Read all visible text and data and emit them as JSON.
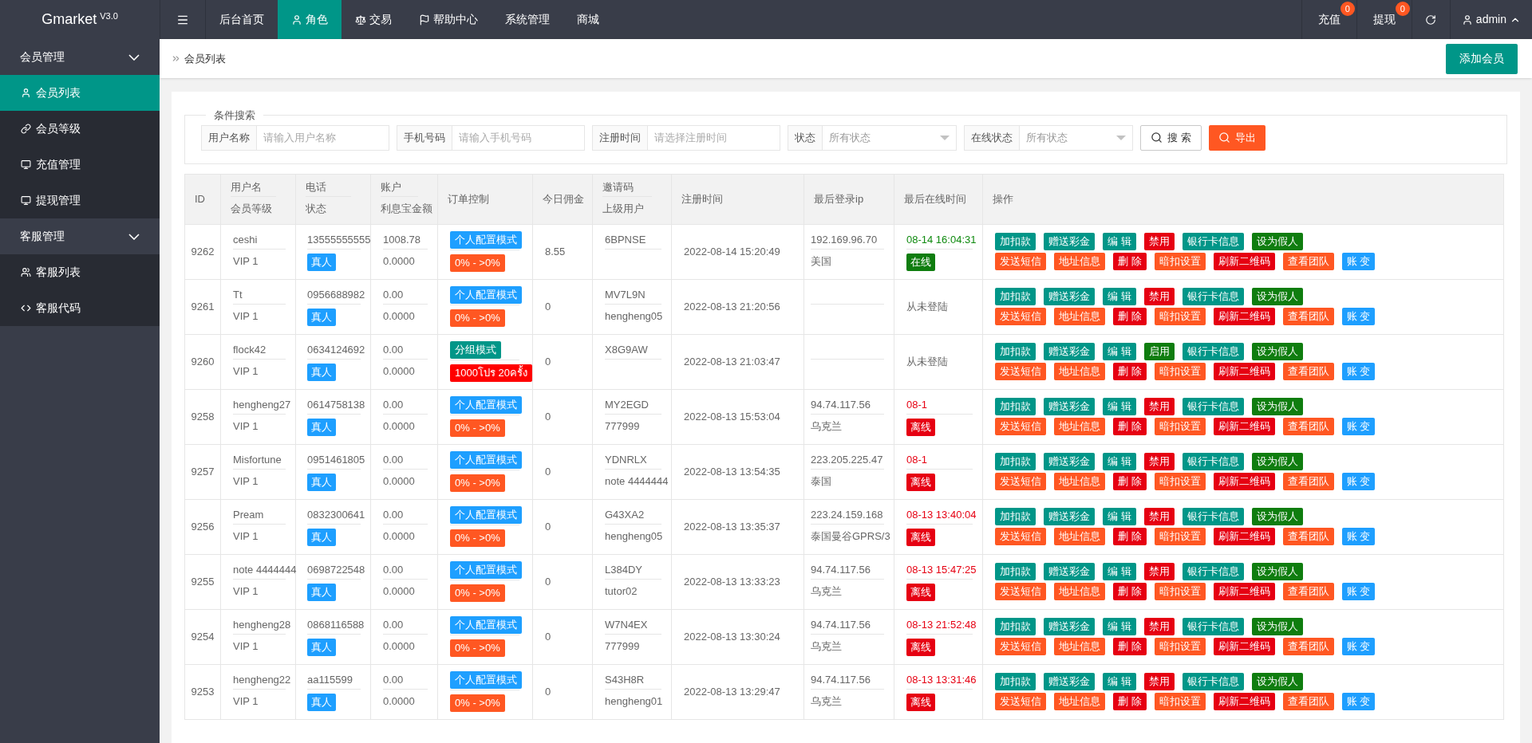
{
  "app": {
    "logo": "Gmarket",
    "version": "V3.0"
  },
  "top_nav": [
    {
      "label": "后台首页",
      "selected": false
    },
    {
      "label": "角色",
      "selected": true
    },
    {
      "label": "交易",
      "selected": false
    },
    {
      "label": "帮助中心",
      "selected": false
    },
    {
      "label": "系统管理",
      "selected": false
    },
    {
      "label": "商城",
      "selected": false
    }
  ],
  "top_right": [
    {
      "label": "充值",
      "badge": "0"
    },
    {
      "label": "提现",
      "badge": "0"
    }
  ],
  "user": "admin",
  "sidebar": [
    {
      "label": "会员管理",
      "expanded": true,
      "items": [
        {
          "label": "会员列表",
          "selected": true
        },
        {
          "label": "会员等级",
          "selected": false
        },
        {
          "label": "充值管理",
          "selected": false
        },
        {
          "label": "提现管理",
          "selected": false
        }
      ]
    },
    {
      "label": "客服管理",
      "expanded": true,
      "items": [
        {
          "label": "客服列表",
          "selected": false
        },
        {
          "label": "客服代码",
          "selected": false
        }
      ]
    }
  ],
  "breadcrumb": "会员列表",
  "add_button": "添加会员",
  "search": {
    "legend": "条件搜索",
    "fields": [
      {
        "kind": "text",
        "label": "用户名称",
        "placeholder": "请输入用户名称"
      },
      {
        "kind": "text",
        "label": "手机号码",
        "placeholder": "请输入手机号码"
      },
      {
        "kind": "text",
        "label": "注册时间",
        "placeholder": "请选择注册时间"
      },
      {
        "kind": "select",
        "label": "状态",
        "placeholder": "所有状态"
      },
      {
        "kind": "select",
        "label": "在线状态",
        "placeholder": "所有状态"
      }
    ],
    "buttons": [
      {
        "kind": "outline",
        "label": "搜 索"
      },
      {
        "kind": "primary",
        "label": "导出"
      }
    ]
  },
  "table": {
    "columns": [
      [
        "ID"
      ],
      [
        "用户名",
        "会员等级"
      ],
      [
        "电话",
        "状态"
      ],
      [
        "账户",
        "利息宝金额"
      ],
      [
        "订单控制"
      ],
      [
        "今日佣金"
      ],
      [
        "邀请码",
        "上级用户"
      ],
      [
        "注册时间"
      ],
      [
        "最后登录ip"
      ],
      [
        "最后在线时间"
      ],
      [
        "操作"
      ]
    ],
    "rows": [
      {
        "id": "9262",
        "username": "ceshi",
        "level": "VIP 1",
        "phone": "13555555555",
        "member_type": "真人",
        "balance": "1008.78",
        "interest": "0.0000",
        "order_mode": {
          "label": "个人配置模式",
          "color": "#1e9fff"
        },
        "order_range": {
          "label": "0% - >0%",
          "color": "#ff5722"
        },
        "commission": "8.55",
        "invite_code": "6BPNSE",
        "registered": "2022-08-14 15:20:49",
        "ip": "192.169.96.70",
        "location": "美国",
        "last_online": {
          "kind": "online",
          "text": "08-14 16:04:31",
          "badge": "在线"
        },
        "action_rows": [
          [
            {
              "label": "加扣款",
              "color": "#009688"
            },
            {
              "label": "赠送彩金",
              "color": "#009688"
            },
            {
              "label": "编 辑",
              "color": "#009688"
            },
            {
              "label": "禁用",
              "color": "#e60012"
            },
            {
              "label": "银行卡信息",
              "color": "#009688"
            },
            {
              "label": "设为假人",
              "color": "#0f7d0f"
            }
          ],
          [
            {
              "label": "发送短信",
              "color": "#ff5722"
            },
            {
              "label": "地址信息",
              "color": "#ff5722"
            },
            {
              "label": "删 除",
              "color": "#e60012"
            },
            {
              "label": "暗扣设置",
              "color": "#ff5722"
            },
            {
              "label": "刷新二维码",
              "color": "#e60012"
            },
            {
              "label": "查看团队",
              "color": "#ff5722"
            },
            {
              "label": "账 变",
              "color": "#1e9fff"
            }
          ]
        ]
      },
      {
        "id": "9261",
        "username": "Tt",
        "level": "VIP 1",
        "phone": "0956688982",
        "member_type": "真人",
        "balance": "0.00",
        "interest": "0.0000",
        "order_mode": {
          "label": "个人配置模式",
          "color": "#1e9fff"
        },
        "order_range": {
          "label": "0% - >0%",
          "color": "#ff5722"
        },
        "commission": "0",
        "invite_code": "MV7L9N",
        "parent": "hengheng05",
        "registered": "2022-08-13 21:20:56",
        "last_online": {
          "kind": "never",
          "text": "从未登陆"
        },
        "action_rows": [
          [
            {
              "label": "加扣款",
              "color": "#009688"
            },
            {
              "label": "赠送彩金",
              "color": "#009688"
            },
            {
              "label": "编 辑",
              "color": "#009688"
            },
            {
              "label": "禁用",
              "color": "#e60012"
            },
            {
              "label": "银行卡信息",
              "color": "#009688"
            },
            {
              "label": "设为假人",
              "color": "#0f7d0f"
            }
          ],
          [
            {
              "label": "发送短信",
              "color": "#ff5722"
            },
            {
              "label": "地址信息",
              "color": "#ff5722"
            },
            {
              "label": "删 除",
              "color": "#e60012"
            },
            {
              "label": "暗扣设置",
              "color": "#ff5722"
            },
            {
              "label": "刷新二维码",
              "color": "#e60012"
            },
            {
              "label": "查看团队",
              "color": "#ff5722"
            },
            {
              "label": "账 变",
              "color": "#1e9fff"
            }
          ]
        ]
      },
      {
        "id": "9260",
        "username": "flock42",
        "level": "VIP 1",
        "phone": "0634124692",
        "member_type": "真人",
        "balance": "0.00",
        "interest": "0.0000",
        "order_mode": {
          "label": "分组模式",
          "color": "#009688"
        },
        "order_range": {
          "label": "1000โปร 20ครั้ง",
          "color": "#ff0000"
        },
        "commission": "0",
        "invite_code": "X8G9AW",
        "registered": "2022-08-13 21:03:47",
        "last_online": {
          "kind": "never",
          "text": "从未登陆"
        },
        "action_rows": [
          [
            {
              "label": "加扣款",
              "color": "#009688"
            },
            {
              "label": "赠送彩金",
              "color": "#009688"
            },
            {
              "label": "编 辑",
              "color": "#009688"
            },
            {
              "label": "启用",
              "color": "#0f7d0f"
            },
            {
              "label": "银行卡信息",
              "color": "#009688"
            },
            {
              "label": "设为假人",
              "color": "#0f7d0f"
            }
          ],
          [
            {
              "label": "发送短信",
              "color": "#ff5722"
            },
            {
              "label": "地址信息",
              "color": "#ff5722"
            },
            {
              "label": "删 除",
              "color": "#e60012"
            },
            {
              "label": "暗扣设置",
              "color": "#ff5722"
            },
            {
              "label": "刷新二维码",
              "color": "#e60012"
            },
            {
              "label": "查看团队",
              "color": "#ff5722"
            },
            {
              "label": "账 变",
              "color": "#1e9fff"
            }
          ]
        ]
      },
      {
        "id": "9258",
        "username": "hengheng27",
        "level": "VIP 1",
        "phone": "0614758138",
        "member_type": "真人",
        "balance": "0.00",
        "interest": "0.0000",
        "order_mode": {
          "label": "个人配置模式",
          "color": "#1e9fff"
        },
        "order_range": {
          "label": "0% - >0%",
          "color": "#ff5722"
        },
        "commission": "0",
        "invite_code": "MY2EGD",
        "parent": "777999",
        "registered": "2022-08-13 15:53:04",
        "ip": "94.74.117.56",
        "location": "乌克兰",
        "last_online": {
          "kind": "offline",
          "text": "08-1",
          "badge": "离线"
        },
        "action_rows": [
          [
            {
              "label": "加扣款",
              "color": "#009688"
            },
            {
              "label": "赠送彩金",
              "color": "#009688"
            },
            {
              "label": "编 辑",
              "color": "#009688"
            },
            {
              "label": "禁用",
              "color": "#e60012"
            },
            {
              "label": "银行卡信息",
              "color": "#009688"
            },
            {
              "label": "设为假人",
              "color": "#0f7d0f"
            }
          ],
          [
            {
              "label": "发送短信",
              "color": "#ff5722"
            },
            {
              "label": "地址信息",
              "color": "#ff5722"
            },
            {
              "label": "删 除",
              "color": "#e60012"
            },
            {
              "label": "暗扣设置",
              "color": "#ff5722"
            },
            {
              "label": "刷新二维码",
              "color": "#e60012"
            },
            {
              "label": "查看团队",
              "color": "#ff5722"
            },
            {
              "label": "账 变",
              "color": "#1e9fff"
            }
          ]
        ]
      },
      {
        "id": "9257",
        "username": "Misfortune",
        "level": "VIP 1",
        "phone": "0951461805",
        "member_type": "真人",
        "balance": "0.00",
        "interest": "0.0000",
        "order_mode": {
          "label": "个人配置模式",
          "color": "#1e9fff"
        },
        "order_range": {
          "label": "0% - >0%",
          "color": "#ff5722"
        },
        "commission": "0",
        "invite_code": "YDNRLX",
        "parent": "note 4444444",
        "registered": "2022-08-13 13:54:35",
        "ip": "223.205.225.47",
        "location": "泰国",
        "last_online": {
          "kind": "offline",
          "text": "08-1",
          "badge": "离线"
        },
        "action_rows": [
          [
            {
              "label": "加扣款",
              "color": "#009688"
            },
            {
              "label": "赠送彩金",
              "color": "#009688"
            },
            {
              "label": "编 辑",
              "color": "#009688"
            },
            {
              "label": "禁用",
              "color": "#e60012"
            },
            {
              "label": "银行卡信息",
              "color": "#009688"
            },
            {
              "label": "设为假人",
              "color": "#0f7d0f"
            }
          ],
          [
            {
              "label": "发送短信",
              "color": "#ff5722"
            },
            {
              "label": "地址信息",
              "color": "#ff5722"
            },
            {
              "label": "删 除",
              "color": "#e60012"
            },
            {
              "label": "暗扣设置",
              "color": "#ff5722"
            },
            {
              "label": "刷新二维码",
              "color": "#e60012"
            },
            {
              "label": "查看团队",
              "color": "#ff5722"
            },
            {
              "label": "账 变",
              "color": "#1e9fff"
            }
          ]
        ]
      },
      {
        "id": "9256",
        "username": "Pream",
        "level": "VIP 1",
        "phone": "0832300641",
        "member_type": "真人",
        "balance": "0.00",
        "interest": "0.0000",
        "order_mode": {
          "label": "个人配置模式",
          "color": "#1e9fff"
        },
        "order_range": {
          "label": "0% - >0%",
          "color": "#ff5722"
        },
        "commission": "0",
        "invite_code": "G43XA2",
        "parent": "hengheng05",
        "registered": "2022-08-13 13:35:37",
        "ip": "223.24.159.168",
        "location": "泰国曼谷GPRS/3",
        "last_online": {
          "kind": "offline",
          "text": "08-13 13:40:04",
          "badge": "离线"
        },
        "action_rows": [
          [
            {
              "label": "加扣款",
              "color": "#009688"
            },
            {
              "label": "赠送彩金",
              "color": "#009688"
            },
            {
              "label": "编 辑",
              "color": "#009688"
            },
            {
              "label": "禁用",
              "color": "#e60012"
            },
            {
              "label": "银行卡信息",
              "color": "#009688"
            },
            {
              "label": "设为假人",
              "color": "#0f7d0f"
            }
          ],
          [
            {
              "label": "发送短信",
              "color": "#ff5722"
            },
            {
              "label": "地址信息",
              "color": "#ff5722"
            },
            {
              "label": "删 除",
              "color": "#e60012"
            },
            {
              "label": "暗扣设置",
              "color": "#ff5722"
            },
            {
              "label": "刷新二维码",
              "color": "#e60012"
            },
            {
              "label": "查看团队",
              "color": "#ff5722"
            },
            {
              "label": "账 变",
              "color": "#1e9fff"
            }
          ]
        ]
      },
      {
        "id": "9255",
        "username": "note 4444444",
        "level": "VIP 1",
        "phone": "0698722548",
        "member_type": "真人",
        "balance": "0.00",
        "interest": "0.0000",
        "order_mode": {
          "label": "个人配置模式",
          "color": "#1e9fff"
        },
        "order_range": {
          "label": "0% - >0%",
          "color": "#ff5722"
        },
        "commission": "0",
        "invite_code": "L384DY",
        "parent": "tutor02",
        "registered": "2022-08-13 13:33:23",
        "ip": "94.74.117.56",
        "location": "乌克兰",
        "last_online": {
          "kind": "offline",
          "text": "08-13 15:47:25",
          "badge": "离线"
        },
        "action_rows": [
          [
            {
              "label": "加扣款",
              "color": "#009688"
            },
            {
              "label": "赠送彩金",
              "color": "#009688"
            },
            {
              "label": "编 辑",
              "color": "#009688"
            },
            {
              "label": "禁用",
              "color": "#e60012"
            },
            {
              "label": "银行卡信息",
              "color": "#009688"
            },
            {
              "label": "设为假人",
              "color": "#0f7d0f"
            }
          ],
          [
            {
              "label": "发送短信",
              "color": "#ff5722"
            },
            {
              "label": "地址信息",
              "color": "#ff5722"
            },
            {
              "label": "删 除",
              "color": "#e60012"
            },
            {
              "label": "暗扣设置",
              "color": "#ff5722"
            },
            {
              "label": "刷新二维码",
              "color": "#e60012"
            },
            {
              "label": "查看团队",
              "color": "#ff5722"
            },
            {
              "label": "账 变",
              "color": "#1e9fff"
            }
          ]
        ]
      },
      {
        "id": "9254",
        "username": "hengheng28",
        "level": "VIP 1",
        "phone": "0868116588",
        "member_type": "真人",
        "balance": "0.00",
        "interest": "0.0000",
        "order_mode": {
          "label": "个人配置模式",
          "color": "#1e9fff"
        },
        "order_range": {
          "label": "0% - >0%",
          "color": "#ff5722"
        },
        "commission": "0",
        "invite_code": "W7N4EX",
        "parent": "777999",
        "registered": "2022-08-13 13:30:24",
        "ip": "94.74.117.56",
        "location": "乌克兰",
        "last_online": {
          "kind": "offline",
          "text": "08-13 21:52:48",
          "badge": "离线"
        },
        "action_rows": [
          [
            {
              "label": "加扣款",
              "color": "#009688"
            },
            {
              "label": "赠送彩金",
              "color": "#009688"
            },
            {
              "label": "编 辑",
              "color": "#009688"
            },
            {
              "label": "禁用",
              "color": "#e60012"
            },
            {
              "label": "银行卡信息",
              "color": "#009688"
            },
            {
              "label": "设为假人",
              "color": "#0f7d0f"
            }
          ],
          [
            {
              "label": "发送短信",
              "color": "#ff5722"
            },
            {
              "label": "地址信息",
              "color": "#ff5722"
            },
            {
              "label": "删 除",
              "color": "#e60012"
            },
            {
              "label": "暗扣设置",
              "color": "#ff5722"
            },
            {
              "label": "刷新二维码",
              "color": "#e60012"
            },
            {
              "label": "查看团队",
              "color": "#ff5722"
            },
            {
              "label": "账 变",
              "color": "#1e9fff"
            }
          ]
        ]
      },
      {
        "id": "9253",
        "username": "hengheng22",
        "level": "VIP 1",
        "phone": "aa115599",
        "member_type": "真人",
        "balance": "0.00",
        "interest": "0.0000",
        "order_mode": {
          "label": "个人配置模式",
          "color": "#1e9fff"
        },
        "order_range": {
          "label": "0% - >0%",
          "color": "#ff5722"
        },
        "commission": "0",
        "invite_code": "S43H8R",
        "parent": "hengheng01",
        "registered": "2022-08-13 13:29:47",
        "ip": "94.74.117.56",
        "location": "乌克兰",
        "last_online": {
          "kind": "offline",
          "text": "08-13 13:31:46",
          "badge": "离线"
        },
        "action_rows": [
          [
            {
              "label": "加扣款",
              "color": "#009688"
            },
            {
              "label": "赠送彩金",
              "color": "#009688"
            },
            {
              "label": "编 辑",
              "color": "#009688"
            },
            {
              "label": "禁用",
              "color": "#e60012"
            },
            {
              "label": "银行卡信息",
              "color": "#009688"
            },
            {
              "label": "设为假人",
              "color": "#0f7d0f"
            }
          ],
          [
            {
              "label": "发送短信",
              "color": "#ff5722"
            },
            {
              "label": "地址信息",
              "color": "#ff5722"
            },
            {
              "label": "删 除",
              "color": "#e60012"
            },
            {
              "label": "暗扣设置",
              "color": "#ff5722"
            },
            {
              "label": "刷新二维码",
              "color": "#e60012"
            },
            {
              "label": "查看团队",
              "color": "#ff5722"
            },
            {
              "label": "账 变",
              "color": "#1e9fff"
            }
          ]
        ]
      }
    ]
  }
}
